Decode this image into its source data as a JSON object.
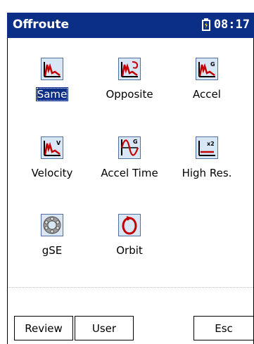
{
  "window": {
    "title": "Offroute",
    "time": "08:17"
  },
  "icons": [
    {
      "label": "Same",
      "icon": "spectrum-same-icon",
      "selected": true
    },
    {
      "label": "Opposite",
      "icon": "spectrum-opposite-icon",
      "selected": false
    },
    {
      "label": "Accel",
      "icon": "spectrum-accel-icon",
      "selected": false
    },
    {
      "label": "Velocity",
      "icon": "spectrum-velocity-icon",
      "selected": false
    },
    {
      "label": "Accel Time",
      "icon": "waveform-accel-time-icon",
      "selected": false
    },
    {
      "label": "High Res.",
      "icon": "high-res-icon",
      "selected": false
    },
    {
      "label": "gSE",
      "icon": "gse-bearing-icon",
      "selected": false
    },
    {
      "label": "Orbit",
      "icon": "orbit-icon",
      "selected": false
    }
  ],
  "buttons": {
    "review": "Review",
    "user": "User",
    "esc": "Esc"
  },
  "colors": {
    "titlebar": "#0b2e86",
    "selection": "#0b2e86"
  }
}
